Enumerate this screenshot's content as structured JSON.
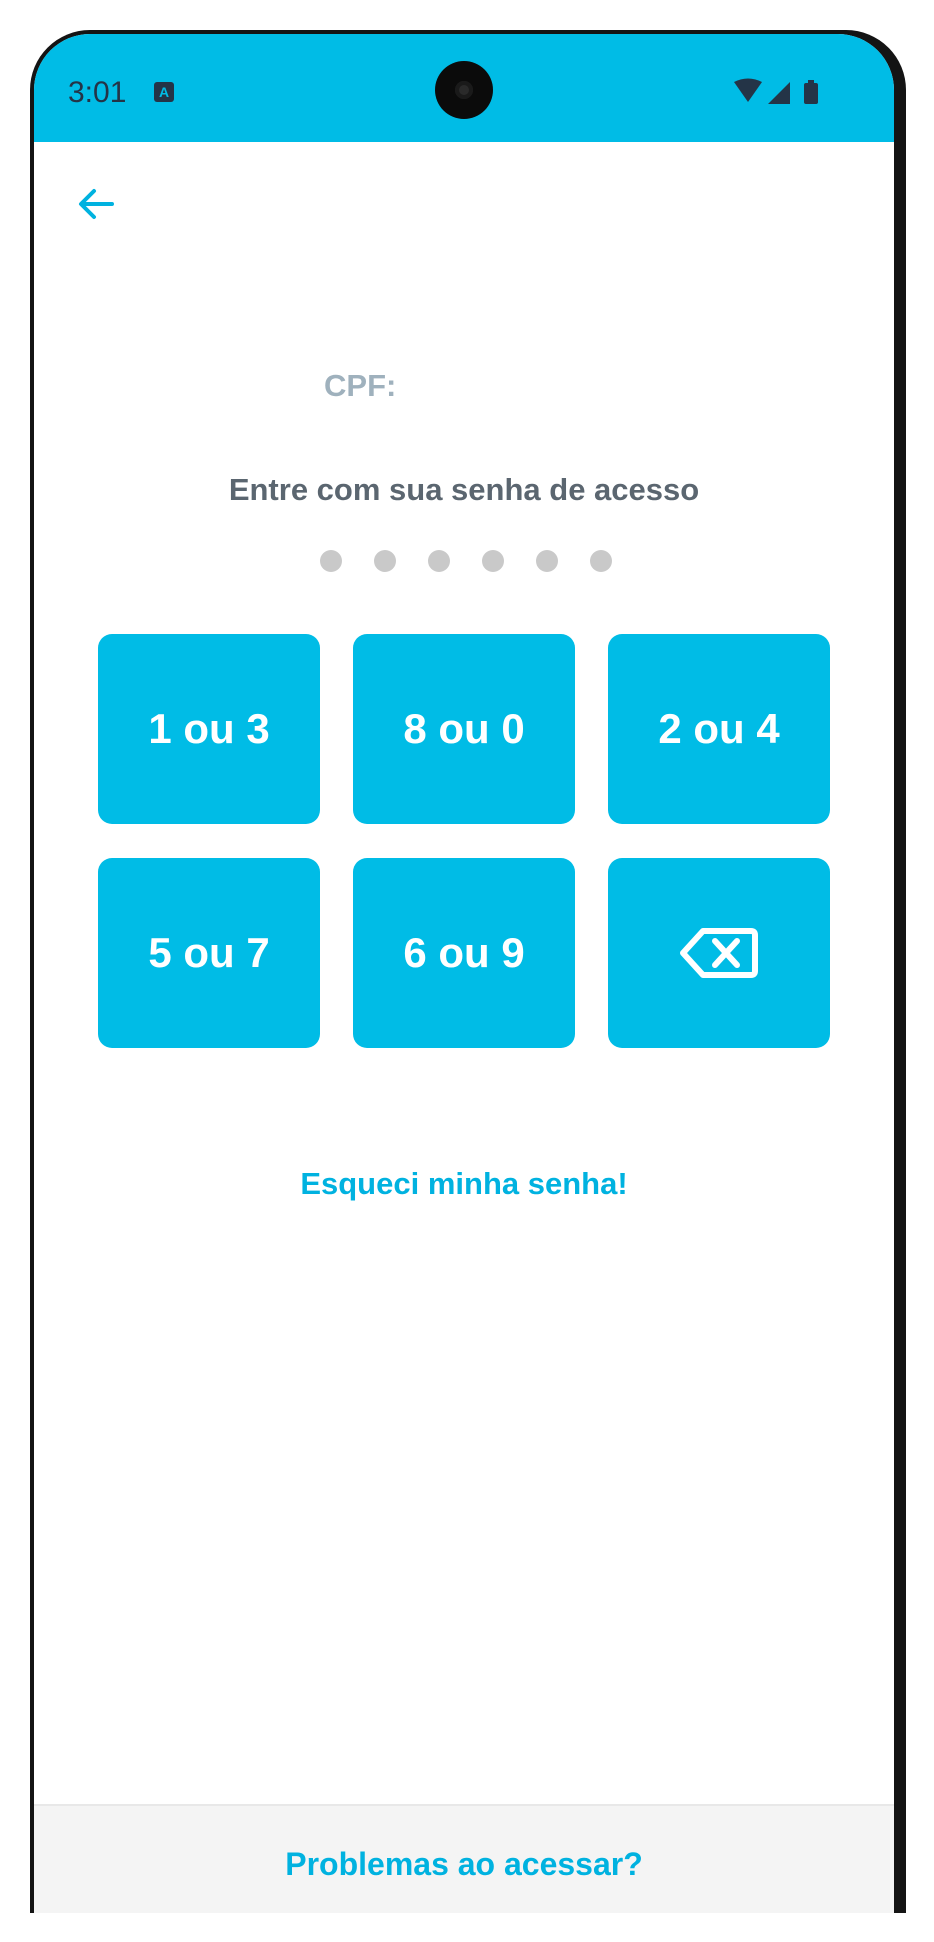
{
  "status_bar": {
    "time": "3:01",
    "notification_icon": "a-letter-icon",
    "icons": [
      "wifi-icon",
      "signal-icon",
      "battery-icon"
    ]
  },
  "header": {
    "back_icon": "arrow-left-icon"
  },
  "cpf": {
    "label": "CPF:"
  },
  "prompt": "Entre com sua senha de acesso",
  "pin": {
    "length": 6,
    "filled": 0
  },
  "keypad": {
    "keys": [
      "1 ou 3",
      "8 ou 0",
      "2 ou 4",
      "5 ou 7",
      "6 ou 9"
    ],
    "delete_icon": "backspace-icon"
  },
  "forgot_password": "Esqueci minha senha!",
  "footer": {
    "problems_link": "Problemas ao acessar?"
  },
  "colors": {
    "accent": "#00bce6",
    "link": "#00b2e0",
    "label_muted": "#9fb1bd",
    "text_dark": "#5b6670",
    "dot_empty": "#c9c9c9"
  }
}
